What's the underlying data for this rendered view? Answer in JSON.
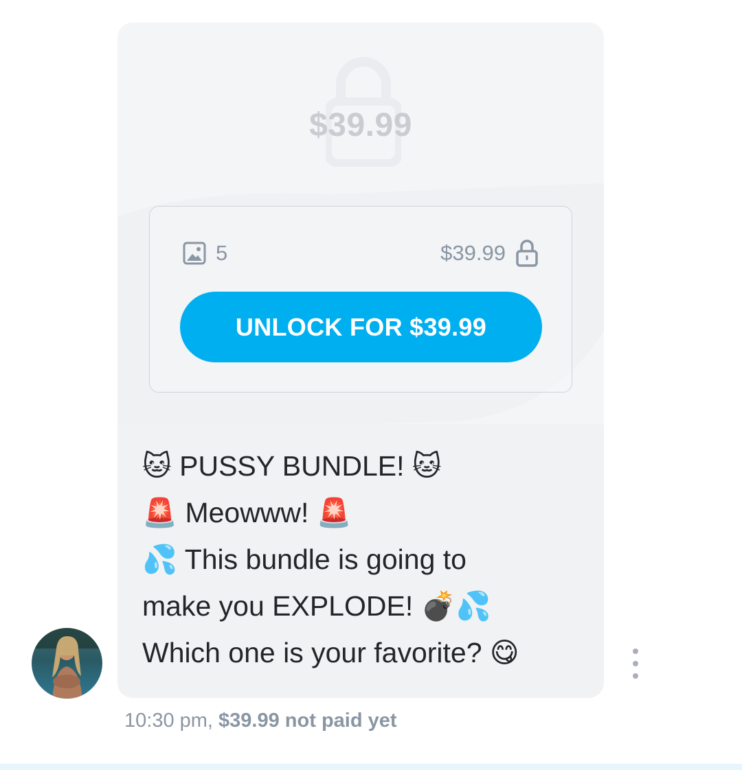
{
  "post": {
    "preview_price": "$39.99",
    "media_count": "5",
    "card_price": "$39.99",
    "unlock_label": "UNLOCK FOR $39.99"
  },
  "message": {
    "lines": [
      "🐱 PUSSY BUNDLE! 🐱",
      "🚨 Meowww! 🚨",
      "💦 This bundle is going to",
      "make you EXPLODE! 💣💦",
      "Which one is your favorite? 😋"
    ]
  },
  "meta": {
    "time": "10:30 pm,",
    "price_status": "$39.99 not paid yet"
  },
  "icons": {
    "preview_lock": "lock-icon",
    "media": "image-icon",
    "price_lock": "lock-icon",
    "more": "more-vertical-icon"
  },
  "colors": {
    "accent": "#00aff0",
    "muted_text": "#8a96a3",
    "bubble": "#f1f2f4"
  }
}
